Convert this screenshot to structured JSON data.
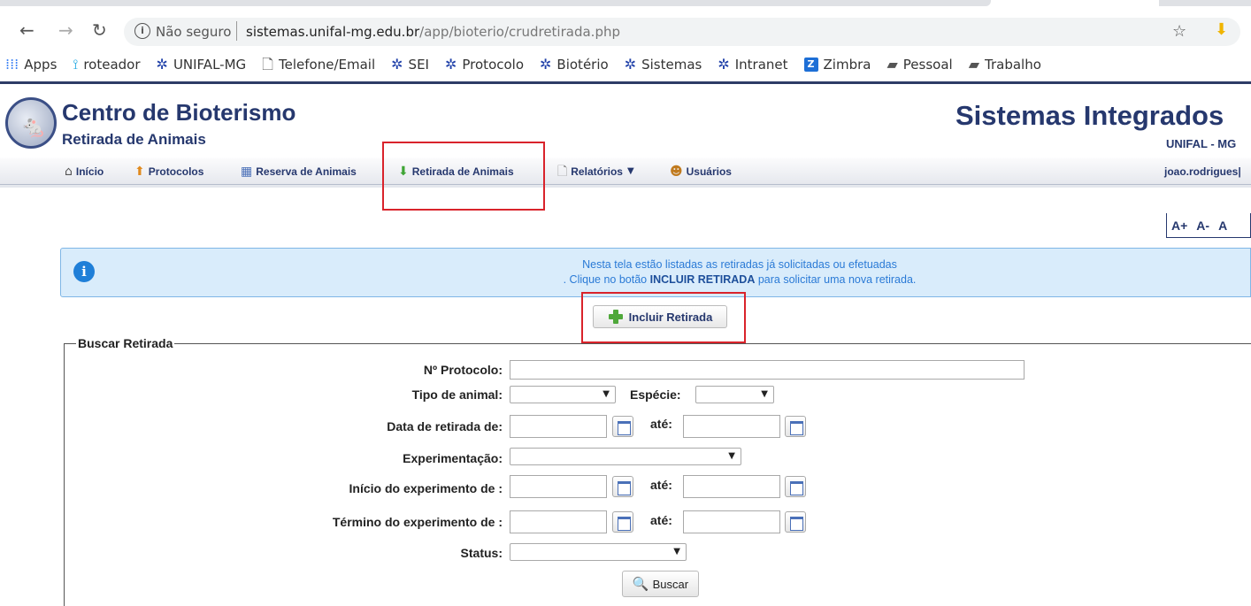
{
  "browser": {
    "security_label": "Não seguro",
    "url_host": "sistemas.unifal-mg.edu.br",
    "url_path": "/app/bioterio/crudretirada.php",
    "bookmarks": [
      {
        "label": "Apps",
        "icon": "apps-grid-icon"
      },
      {
        "label": "roteador",
        "icon": "router-icon"
      },
      {
        "label": "UNIFAL-MG",
        "icon": "unifal-star-icon"
      },
      {
        "label": "Telefone/Email",
        "icon": "page-icon"
      },
      {
        "label": "SEI",
        "icon": "unifal-star-icon"
      },
      {
        "label": "Protocolo",
        "icon": "unifal-star-icon"
      },
      {
        "label": "Biotério",
        "icon": "unifal-star-icon"
      },
      {
        "label": "Sistemas",
        "icon": "unifal-star-icon"
      },
      {
        "label": "Intranet",
        "icon": "unifal-star-icon"
      },
      {
        "label": "Zimbra",
        "icon": "zimbra-icon"
      },
      {
        "label": "Pessoal",
        "icon": "folder-icon"
      },
      {
        "label": "Trabalho",
        "icon": "folder-icon"
      }
    ]
  },
  "header": {
    "title": "Centro de Bioterismo",
    "subtitle": "Retirada de Animais",
    "system_name": "Sistemas Integrados",
    "institution": "UNIFAL - MG",
    "user": "joao.rodrigues|"
  },
  "menu": {
    "items": [
      {
        "label": "Início",
        "icon": "home-icon"
      },
      {
        "label": "Protocolos",
        "icon": "protocol-icon"
      },
      {
        "label": "Reserva de Animais",
        "icon": "calendar-icon"
      },
      {
        "label": "Retirada de Animais",
        "icon": "green-down-arrow-icon"
      },
      {
        "label": "Relatórios",
        "icon": "report-icon"
      },
      {
        "label": "Usuários",
        "icon": "users-icon"
      }
    ]
  },
  "font_controls": [
    "A+",
    "A-",
    "A"
  ],
  "info": {
    "line1": "Nesta tela estão listadas as retiradas já solicitadas ou efetuadas",
    "line2_pre": ". Clique no botão ",
    "line2_bold": "INCLUIR RETIRADA",
    "line2_post": " para solicitar uma nova retirada."
  },
  "include_button": "Incluir Retirada",
  "search": {
    "legend": "Buscar Retirada",
    "protocol_label": "Nº Protocolo:",
    "animal_type_label": "Tipo de animal:",
    "species_label": "Espécie:",
    "withdraw_date_label": "Data de retirada de:",
    "until_label": "até:",
    "experiment_label": "Experimentação:",
    "start_label": "Início do experimento de :",
    "end_label": "Término do experimento de :",
    "status_label": "Status:",
    "search_button": "Buscar"
  },
  "colors": {
    "accent": "#26386e",
    "highlight": "#d9232b",
    "info_bg": "#d9ecfb"
  }
}
